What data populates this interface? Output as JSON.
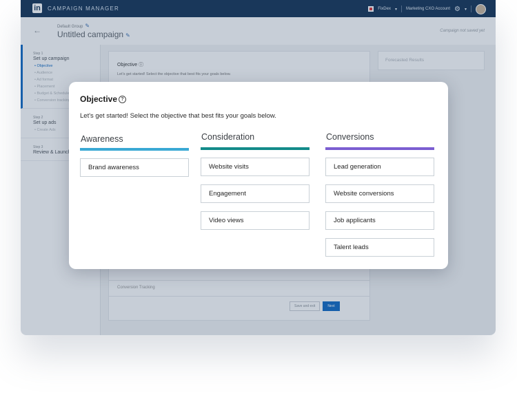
{
  "app": {
    "logo_text": "in",
    "title": "CAMPAIGN MANAGER",
    "account_switcher": "FixDex",
    "account_name": "Marketing CXO Account"
  },
  "header": {
    "group": "Default Group",
    "campaign_title": "Untitled campaign",
    "save_status": "Campaign not saved yet"
  },
  "sidebar": {
    "steps": [
      {
        "number": "Step 1",
        "title": "Set up campaign",
        "items": [
          "Objective",
          "Audience",
          "Ad format",
          "Placement",
          "Budget & Schedule",
          "Conversion tracking"
        ]
      },
      {
        "number": "Step 2",
        "title": "Set up ads",
        "items": [
          "Create Ads"
        ]
      },
      {
        "number": "Step 3",
        "title": "Review & Launch",
        "items": []
      }
    ]
  },
  "background": {
    "objective_title": "Objective",
    "objective_desc": "Let's get started! Select the objective that best fits your goals below.",
    "conversion_tracking": "Conversion Tracking",
    "save_and_exit": "Save and exit",
    "next_button": "Next",
    "forecast_title": "Forecasted Results"
  },
  "modal": {
    "title": "Objective",
    "description": "Let's get started! Select the objective that best fits your goals below.",
    "columns": [
      {
        "heading": "Awareness",
        "color": "#3aa9d4",
        "options": [
          "Brand awareness"
        ]
      },
      {
        "heading": "Consideration",
        "color": "#138b8a",
        "options": [
          "Website visits",
          "Engagement",
          "Video views"
        ]
      },
      {
        "heading": "Conversions",
        "color": "#7b5ed1",
        "options": [
          "Lead generation",
          "Website conversions",
          "Job applicants",
          "Talent leads"
        ]
      }
    ]
  }
}
